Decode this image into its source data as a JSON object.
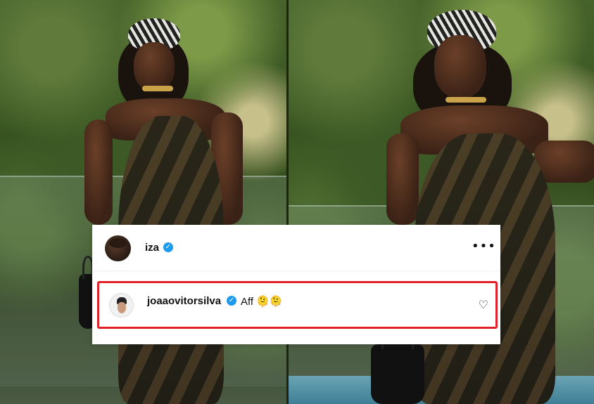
{
  "post": {
    "author": {
      "username": "iza",
      "verified": true,
      "avatar_icon": "profile-photo"
    },
    "more_icon": "more-options-icon",
    "more_glyph": "•••"
  },
  "comment": {
    "username": "joaaovitorsilva",
    "verified": true,
    "text": "Aff 🫠🫠",
    "heart_icon": "heart-outline-icon",
    "heart_glyph": "♡",
    "highlight_color": "#e0202a"
  },
  "verified_glyph": "✓",
  "colors": {
    "verified_badge": "#1d9bf0",
    "card_background": "#ffffff"
  }
}
